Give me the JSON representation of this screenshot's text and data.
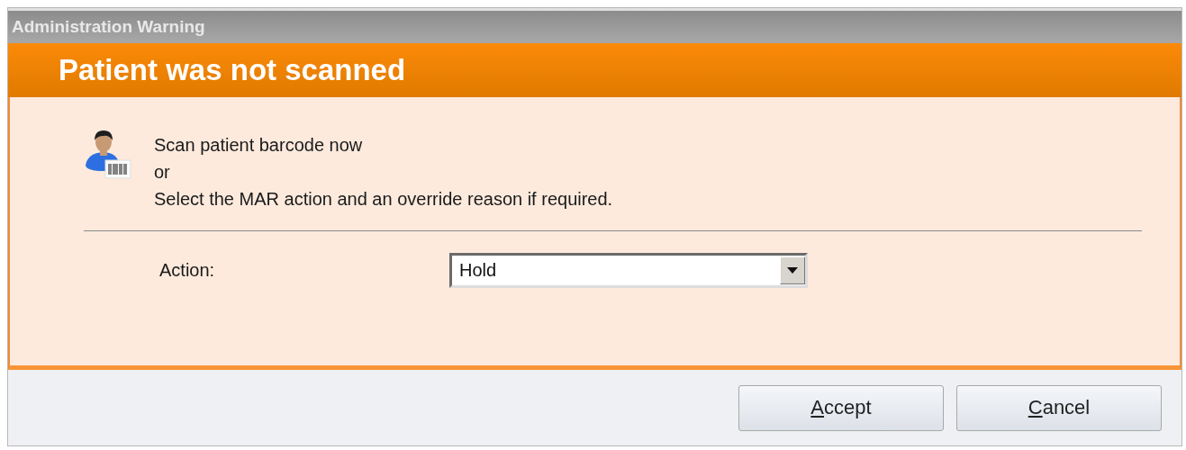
{
  "window": {
    "title": "Administration Warning"
  },
  "header": {
    "title": "Patient was not scanned"
  },
  "message": {
    "lines": [
      "Scan patient barcode now",
      "or",
      "Select the MAR action and an override reason if required."
    ]
  },
  "action": {
    "label": "Action:",
    "value": "Hold"
  },
  "buttons": [
    {
      "label": "Accept"
    },
    {
      "label": "Cancel"
    }
  ]
}
